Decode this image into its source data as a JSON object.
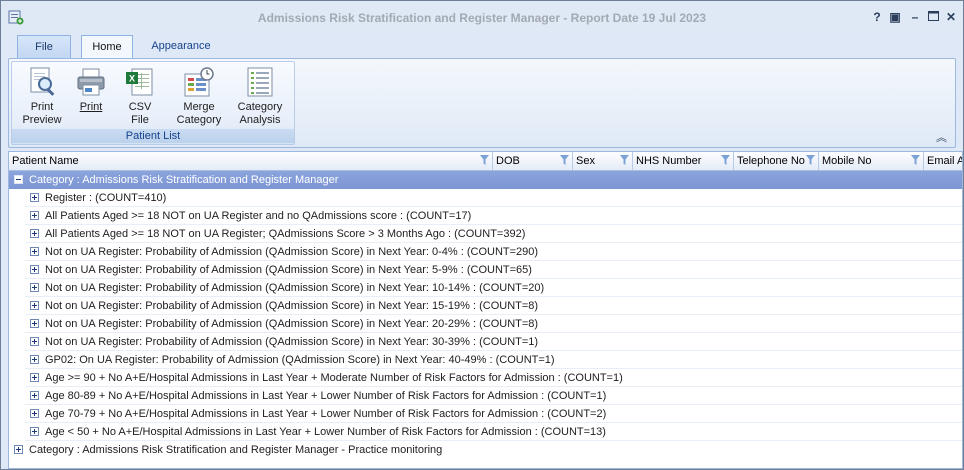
{
  "window": {
    "title": "Admissions Risk Stratification and Register Manager - Report Date 19 Jul 2023",
    "controls": [
      "?",
      "▣",
      "–",
      "✕"
    ]
  },
  "ribbon": {
    "tabs": [
      {
        "label": "File"
      },
      {
        "label": "Home",
        "active": true
      },
      {
        "label": "Appearance"
      }
    ],
    "group_caption": "Patient List",
    "buttons": {
      "print_preview": {
        "line1": "Print",
        "line2": "Preview",
        "icon": "print-preview-icon"
      },
      "print": {
        "line1": "Print",
        "line2": "",
        "icon": "printer-icon"
      },
      "csv": {
        "line1": "CSV",
        "line2": "File",
        "icon": "csv-file-icon"
      },
      "merge": {
        "line1": "Merge",
        "line2": "Category",
        "icon": "merge-category-icon"
      },
      "analysis": {
        "line1": "Category",
        "line2": "Analysis",
        "icon": "category-analysis-icon"
      }
    },
    "collapse_glyph": "︽"
  },
  "grid": {
    "columns": [
      "Patient Name",
      "DOB",
      "Sex",
      "NHS Number",
      "Telephone No",
      "Mobile No",
      "Email A"
    ],
    "category1": "Category : Admissions Risk Stratification and Register Manager",
    "rows": [
      "Register : (COUNT=410)",
      "All Patients Aged >= 18 NOT on UA Register and no QAdmissions score : (COUNT=17)",
      "All Patients Aged >= 18 NOT on UA Register; QAdmissions Score > 3 Months Ago : (COUNT=392)",
      "Not on UA Register: Probability of Admission (QAdmission Score) in Next Year:  0-4% : (COUNT=290)",
      "Not on UA Register: Probability of Admission (QAdmission Score) in Next Year:  5-9% : (COUNT=65)",
      "Not on UA Register: Probability of Admission (QAdmission Score) in Next Year: 10-14% : (COUNT=20)",
      "Not on UA Register:  Probability of Admission (QAdmission Score)  in Next Year:  15-19% : (COUNT=8)",
      "Not on UA Register: Probability of Admission (QAdmission Score) in Next Year:  20-29% : (COUNT=8)",
      "Not on UA Register: Probability of Admission (QAdmission Score) in Next Year: 30-39% : (COUNT=1)",
      "GP02: On UA Register: Probability of Admission (QAdmission Score) in Next Year:  40-49% : (COUNT=1)",
      "Age >= 90 + No A+E/Hospital Admissions in Last Year + Moderate Number of Risk Factors for Admission : (COUNT=1)",
      "Age 80-89 + No A+E/Hospital Admissions in Last Year + Lower Number of Risk Factors for Admission : (COUNT=1)",
      "Age 70-79 + No A+E/Hospital Admissions in Last Year + Lower Number of Risk Factors for Admission : (COUNT=2)",
      "Age < 50 + No A+E/Hospital Admissions in Last Year + Lower Number of Risk Factors for Admission : (COUNT=13)"
    ],
    "category2": "Category : Admissions Risk Stratification and Register Manager - Practice monitoring"
  }
}
